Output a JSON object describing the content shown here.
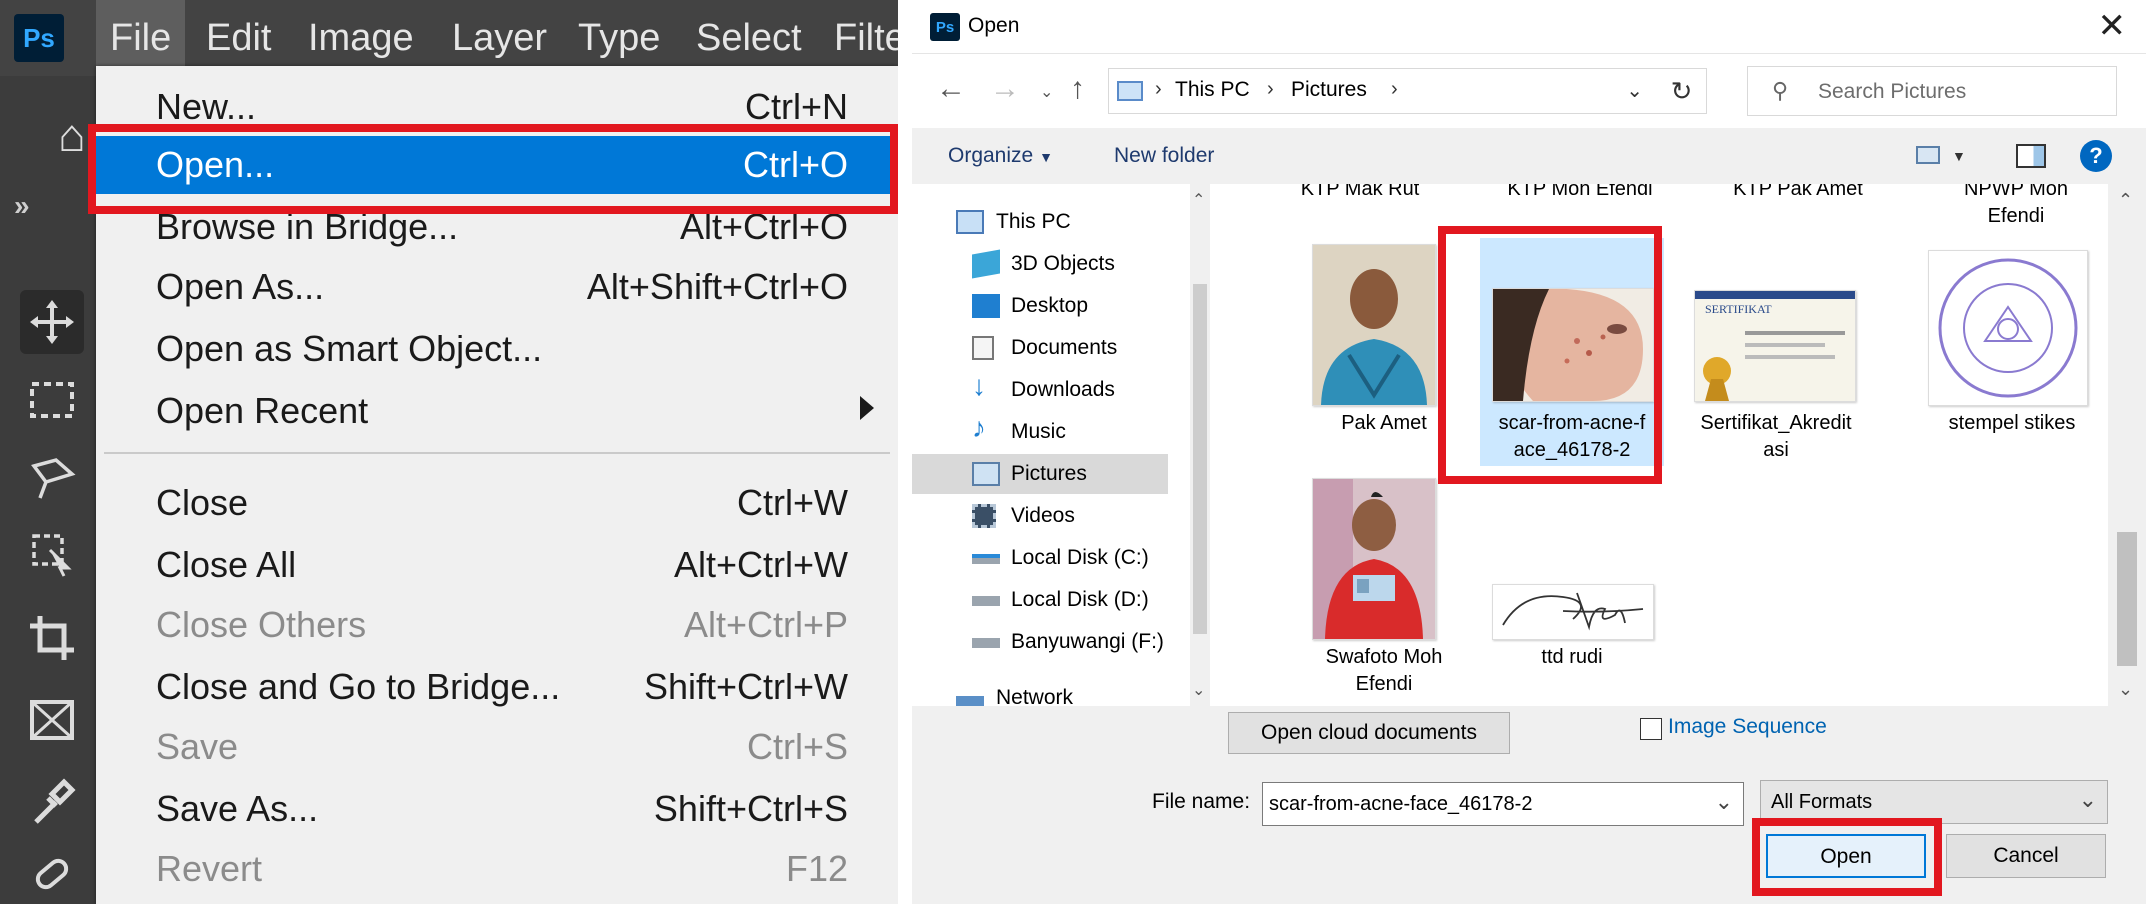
{
  "photoshop": {
    "logo": "Ps",
    "menubar": [
      "File",
      "Edit",
      "Image",
      "Layer",
      "Type",
      "Select",
      "Filte"
    ],
    "active_menu": "File",
    "file_menu": [
      {
        "label": "New...",
        "shortcut": "Ctrl+N",
        "enabled": true
      },
      {
        "label": "Open...",
        "shortcut": "Ctrl+O",
        "enabled": true,
        "highlighted": true
      },
      {
        "label": "Browse in Bridge...",
        "shortcut": "Alt+Ctrl+O",
        "enabled": true
      },
      {
        "label": "Open As...",
        "shortcut": "Alt+Shift+Ctrl+O",
        "enabled": true
      },
      {
        "label": "Open as Smart Object...",
        "shortcut": "",
        "enabled": true
      },
      {
        "label": "Open Recent",
        "shortcut": "",
        "enabled": true,
        "submenu": true
      },
      {
        "label": "Close",
        "shortcut": "Ctrl+W",
        "enabled": true
      },
      {
        "label": "Close All",
        "shortcut": "Alt+Ctrl+W",
        "enabled": true
      },
      {
        "label": "Close Others",
        "shortcut": "Alt+Ctrl+P",
        "enabled": false
      },
      {
        "label": "Close and Go to Bridge...",
        "shortcut": "Shift+Ctrl+W",
        "enabled": true
      },
      {
        "label": "Save",
        "shortcut": "Ctrl+S",
        "enabled": false
      },
      {
        "label": "Save As...",
        "shortcut": "Shift+Ctrl+S",
        "enabled": true
      },
      {
        "label": "Revert",
        "shortcut": "F12",
        "enabled": false
      }
    ],
    "tools": [
      "move-tool-icon",
      "marquee-tool-icon",
      "lasso-tool-icon",
      "object-select-tool-icon",
      "crop-tool-icon",
      "frame-tool-icon",
      "eyedropper-tool-icon",
      "healing-brush-icon"
    ],
    "collapse_glyph": "»"
  },
  "dialog": {
    "title": "Open",
    "icon": "Ps",
    "close_glyph": "✕",
    "breadcrumb": [
      "This PC",
      "Pictures"
    ],
    "search_placeholder": "Search Pictures",
    "commands": {
      "organize": "Organize",
      "new_folder": "New folder"
    },
    "nav_tree": [
      {
        "label": "This PC",
        "icon": "pc-icon"
      },
      {
        "label": "3D Objects",
        "icon": "3d-objects-icon"
      },
      {
        "label": "Desktop",
        "icon": "desktop-icon"
      },
      {
        "label": "Documents",
        "icon": "documents-icon"
      },
      {
        "label": "Downloads",
        "icon": "downloads-icon"
      },
      {
        "label": "Music",
        "icon": "music-icon"
      },
      {
        "label": "Pictures",
        "icon": "pictures-icon",
        "selected": true
      },
      {
        "label": "Videos",
        "icon": "videos-icon"
      },
      {
        "label": "Local Disk (C:)",
        "icon": "drive-icon"
      },
      {
        "label": "Local Disk (D:)",
        "icon": "drive-icon"
      },
      {
        "label": "Banyuwangi (F:)",
        "icon": "drive-icon"
      },
      {
        "label": "Network",
        "icon": "network-icon"
      }
    ],
    "partial_items": [
      "KTP Mak Rut",
      "KTP Moh Efendi",
      "KTP Pak Amet",
      "NPWP Moh\nEfendi"
    ],
    "files": [
      {
        "name": "Pak Amet",
        "thumb": "portrait"
      },
      {
        "name": "scar-from-acne-f\nace_46178-2",
        "thumb": "face",
        "selected": true
      },
      {
        "name": "Sertifikat_Akredit\nasi",
        "thumb": "certificate"
      },
      {
        "name": "stempel stikes",
        "thumb": "stamp"
      },
      {
        "name": "Swafoto Moh\nEfendi",
        "thumb": "selfie"
      },
      {
        "name": "ttd rudi",
        "thumb": "signature"
      }
    ],
    "cloud_button": "Open cloud documents",
    "image_sequence": {
      "label": "Image Sequence",
      "checked": false
    },
    "filename_label": "File name:",
    "filename_value": "scar-from-acne-face_46178-2",
    "format_value": "All Formats",
    "open_button": "Open",
    "cancel_button": "Cancel",
    "help_glyph": "?"
  },
  "colors": {
    "highlight": "#0078d7",
    "annotation_red": "#e2171f",
    "ps_blue": "#31a8ff"
  }
}
